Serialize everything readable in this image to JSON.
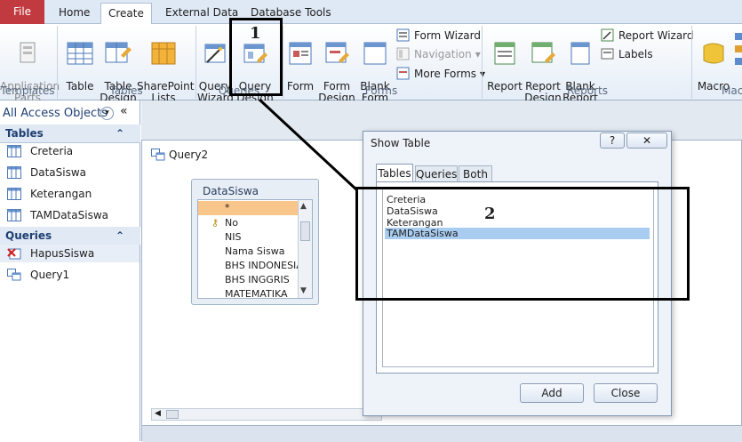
{
  "tabs": [
    "File",
    "Home",
    "Create",
    "External Data",
    "Database Tools"
  ],
  "ribbon": {
    "templates": {
      "app_parts": "Application\nParts",
      "label": "Templates"
    },
    "tables": {
      "table": "Table",
      "table_design": "Table\nDesign",
      "sharepoint": "SharePoint\nLists",
      "label": "Tables"
    },
    "queries": {
      "wizard": "Query\nWizard",
      "design": "Query\nDesign",
      "label": "Queries"
    },
    "forms": {
      "form": "Form",
      "form_design": "Form\nDesign",
      "blank_form": "Blank\nForm",
      "form_wizard": "Form Wizard",
      "navigation": "Navigation",
      "more_forms": "More Forms",
      "label": "Forms"
    },
    "reports": {
      "report": "Report",
      "report_design": "Report\nDesign",
      "blank_report": "Blank\nReport",
      "report_wizard": "Report Wizard",
      "labels": "Labels",
      "label": "Reports"
    },
    "macros": {
      "macro": "Macro",
      "label": "Macr"
    }
  },
  "nav": {
    "header": "All Access Objects",
    "tables_header": "Tables",
    "tables": [
      "Creteria",
      "DataSiswa",
      "Keterangan",
      "TAMDataSiswa"
    ],
    "queries_header": "Queries",
    "queries": [
      "HapusSiswa",
      "Query1"
    ]
  },
  "query_window": {
    "title": "Query2",
    "table_box": {
      "title": "DataSiswa",
      "fields": [
        "*",
        "No",
        "NIS",
        "Nama Siswa",
        "BHS INDONESIA",
        "BHS INGGRIS",
        "MATEMATIKA"
      ]
    }
  },
  "dialog": {
    "title": "Show Table",
    "help": "?",
    "tabs": [
      "Tables",
      "Queries",
      "Both"
    ],
    "items": [
      "Creteria",
      "DataSiswa",
      "Keterangan",
      "TAMDataSiswa"
    ],
    "selected_index": 3,
    "add": "Add",
    "close": "Close"
  },
  "annotations": {
    "step1": "1",
    "step2": "2"
  }
}
